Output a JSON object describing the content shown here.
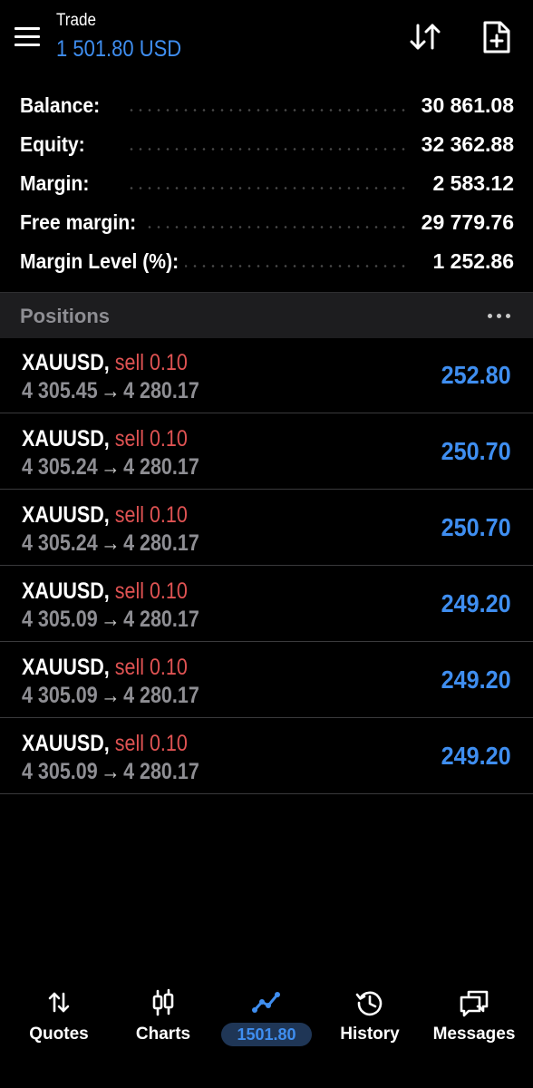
{
  "header": {
    "title": "Trade",
    "subtitle": "1 501.80 USD",
    "menu_icon": "menu-icon",
    "sort_icon": "sort-icon",
    "new_order_icon": "new-order-icon"
  },
  "summary": [
    {
      "label": "Balance:",
      "value": "30 861.08"
    },
    {
      "label": "Equity:",
      "value": "32 362.88"
    },
    {
      "label": "Margin:",
      "value": "2 583.12"
    },
    {
      "label": "Free margin:",
      "value": "29 779.76"
    },
    {
      "label": "Margin Level (%):",
      "value": "1 252.86"
    }
  ],
  "positions_header": {
    "title": "Positions",
    "more_icon": "more-icon"
  },
  "positions": [
    {
      "symbol": "XAUUSD,",
      "side": "sell 0.10",
      "open_price": "4 305.45",
      "arrow": "→",
      "current_price": "4 280.17",
      "profit": "252.80"
    },
    {
      "symbol": "XAUUSD,",
      "side": "sell 0.10",
      "open_price": "4 305.24",
      "arrow": "→",
      "current_price": "4 280.17",
      "profit": "250.70"
    },
    {
      "symbol": "XAUUSD,",
      "side": "sell 0.10",
      "open_price": "4 305.24",
      "arrow": "→",
      "current_price": "4 280.17",
      "profit": "250.70"
    },
    {
      "symbol": "XAUUSD,",
      "side": "sell 0.10",
      "open_price": "4 305.09",
      "arrow": "→",
      "current_price": "4 280.17",
      "profit": "249.20"
    },
    {
      "symbol": "XAUUSD,",
      "side": "sell 0.10",
      "open_price": "4 305.09",
      "arrow": "→",
      "current_price": "4 280.17",
      "profit": "249.20"
    },
    {
      "symbol": "XAUUSD,",
      "side": "sell 0.10",
      "open_price": "4 305.09",
      "arrow": "→",
      "current_price": "4 280.17",
      "profit": "249.20"
    }
  ],
  "bottom_nav": [
    {
      "label": "Quotes",
      "icon": "quotes-icon",
      "active": false
    },
    {
      "label": "Charts",
      "icon": "charts-icon",
      "active": false
    },
    {
      "label": "1501.80",
      "icon": "trade-icon",
      "active": true
    },
    {
      "label": "History",
      "icon": "history-icon",
      "active": false
    },
    {
      "label": "Messages",
      "icon": "messages-icon",
      "active": false
    }
  ],
  "colors": {
    "background": "#000000",
    "accent_blue": "#3f8ef0",
    "sell_red": "#e05353",
    "muted_gray": "#8e8e93",
    "section_bg": "#1d1d1f",
    "active_pill": "#1f3656"
  }
}
